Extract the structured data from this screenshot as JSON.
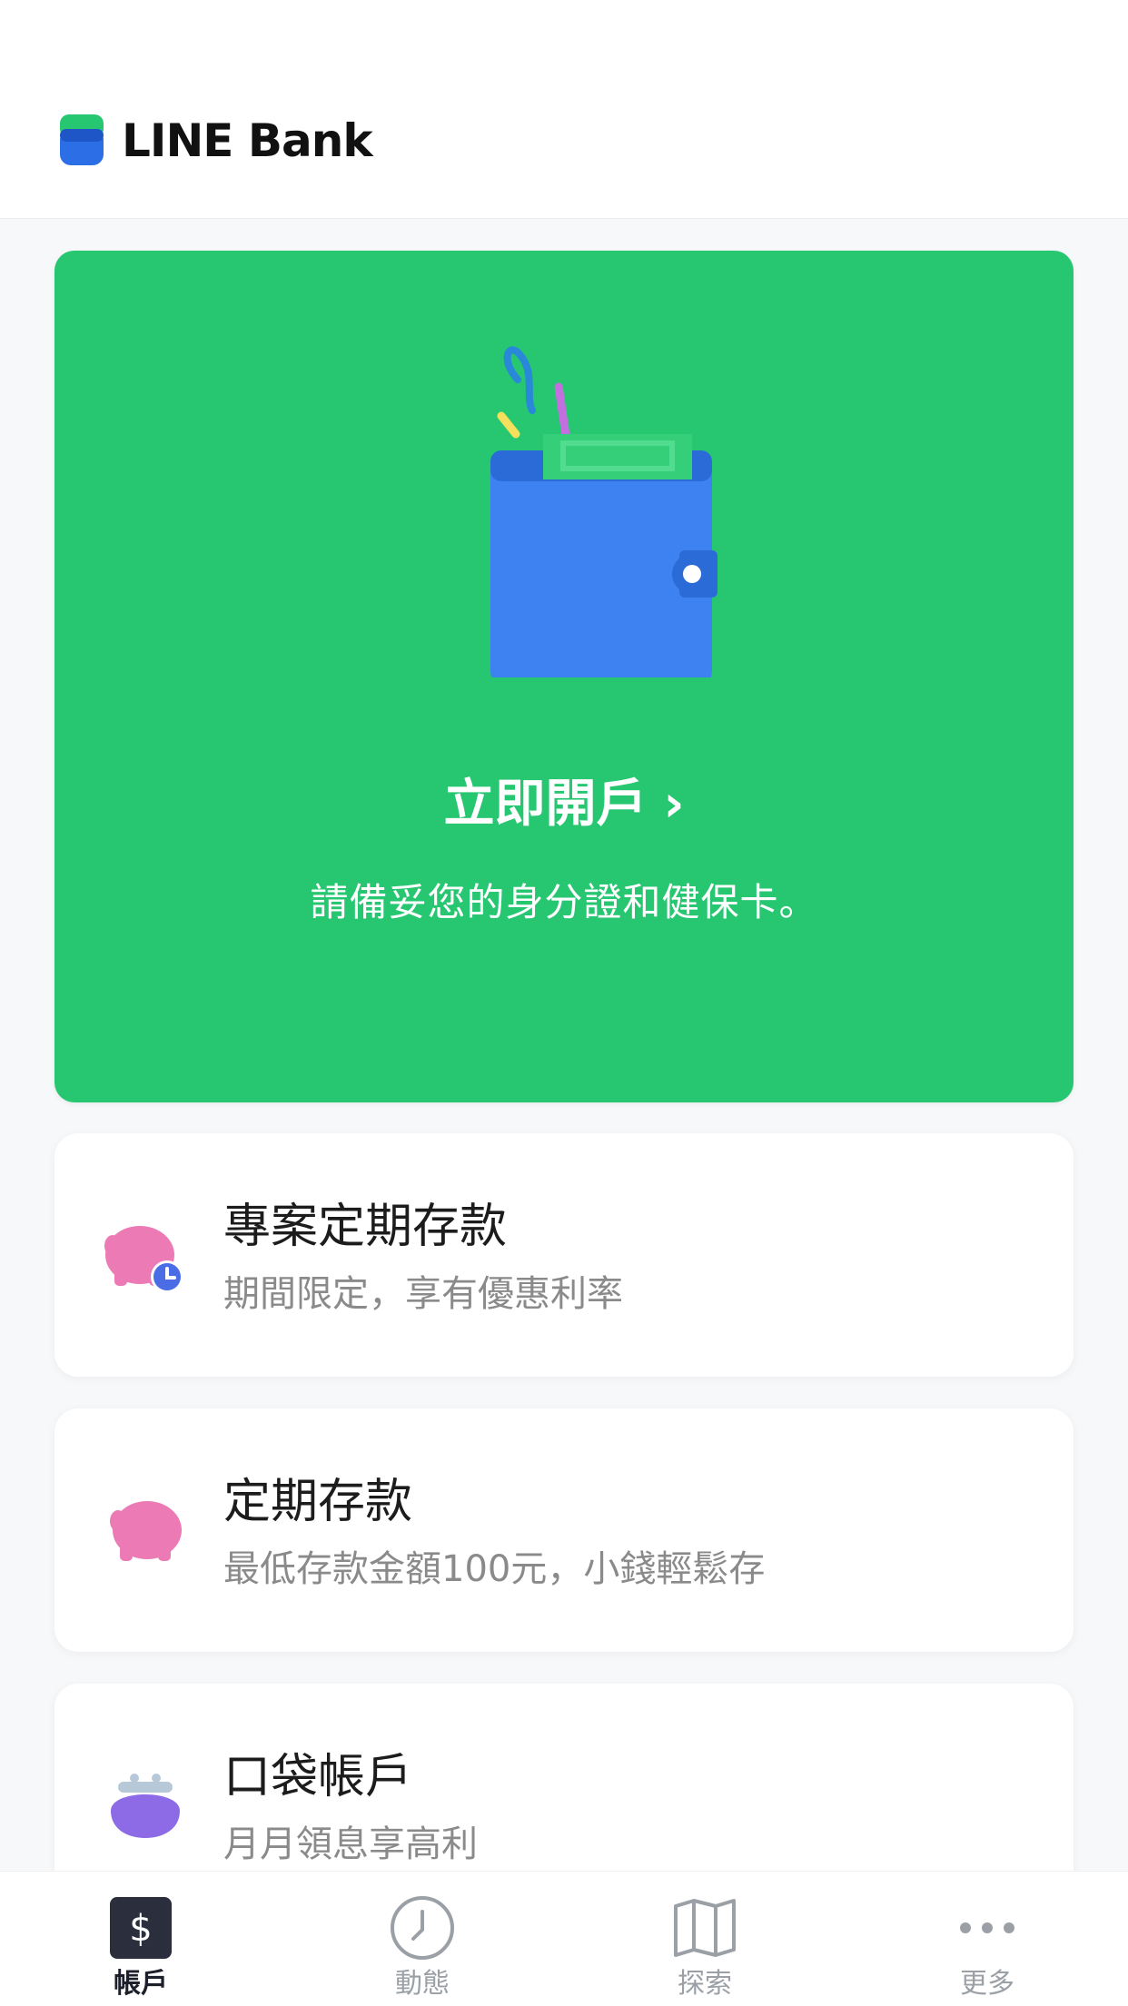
{
  "header": {
    "brand": "LINE Bank"
  },
  "promo": {
    "title": "立即開戶",
    "chevron": "›",
    "subtitle": "請備妥您的身分證和健保卡。",
    "color": "#27c772",
    "icon": "wallet-icon"
  },
  "products": [
    {
      "title": "專案定期存款",
      "subtitle": "期間限定，享有優惠利率",
      "icon": "piggy-bank-clock-icon"
    },
    {
      "title": "定期存款",
      "subtitle": "最低存款金額100元，小錢輕鬆存",
      "icon": "piggy-bank-icon"
    },
    {
      "title": "口袋帳戶",
      "subtitle": "月月領息享高利",
      "icon": "coin-purse-icon"
    }
  ],
  "tabbar": {
    "items": [
      {
        "label": "帳戶",
        "icon": "dollar-icon",
        "active": true
      },
      {
        "label": "動態",
        "icon": "clock-icon",
        "active": false
      },
      {
        "label": "探索",
        "icon": "map-icon",
        "active": false
      },
      {
        "label": "更多",
        "icon": "more-dots-icon",
        "active": false
      }
    ]
  },
  "colors": {
    "accent": "#27c772",
    "wallet": "#3d82f0",
    "pink": "#ec7bb5",
    "purple": "#8e6be6",
    "tab_active": "#2b2f3d"
  }
}
